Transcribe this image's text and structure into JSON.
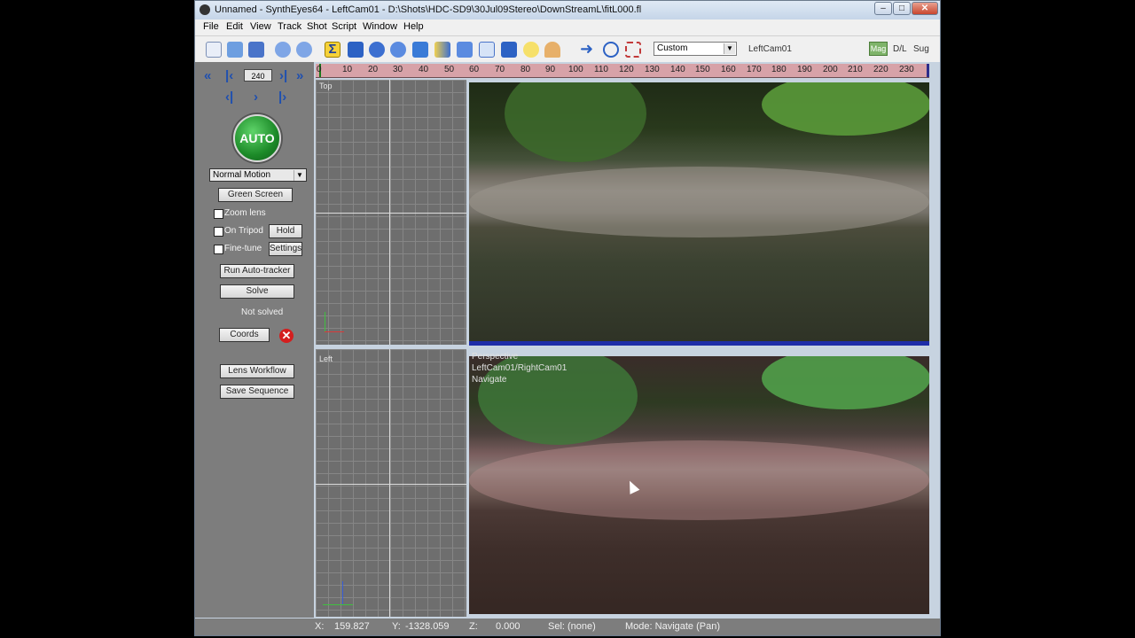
{
  "window": {
    "title": "Unnamed - SynthEyes64 - LeftCam01 - D:\\Shots\\HDC-SD9\\30Jul09Stereo\\DownStreamL\\fitL000.fl",
    "controls": {
      "minimize": "–",
      "maximize": "□",
      "close": "✕"
    }
  },
  "menu": [
    "File",
    "Edit",
    "View",
    "Track",
    "Shot",
    "Script",
    "Window",
    "Help"
  ],
  "toolbar": {
    "icons": [
      "new-file-icon",
      "open-folder-icon",
      "save-icon",
      "undo-icon",
      "redo-icon",
      "summary-icon",
      "camera-view-icon",
      "gear-icon",
      "tracker-icon",
      "move-icon",
      "lens-icon",
      "list-icon",
      "graph-icon",
      "cube-icon",
      "bulb-icon",
      "paint-icon",
      "arrow-right-icon",
      "zoom-icon",
      "fit-icon"
    ],
    "combo_value": "Custom",
    "camera": "LeftCam01",
    "mag_label": "Mag",
    "dl_label": "D/L",
    "sug_label": "Sug"
  },
  "left_panel": {
    "frame": "240",
    "auto_label": "AUTO",
    "motion_select": "Normal Motion",
    "green_screen": "Green Screen",
    "zoom_lens": "Zoom lens",
    "on_tripod": "On Tripod",
    "hold": "Hold",
    "fine_tune": "Fine-tune",
    "settings": "Settings",
    "run_autotracker": "Run Auto-tracker",
    "solve": "Solve",
    "status": "Not solved",
    "coords": "Coords",
    "lens_workflow": "Lens Workflow",
    "save_sequence": "Save Sequence"
  },
  "timebar": {
    "ticks": [
      "0",
      "10",
      "20",
      "30",
      "40",
      "50",
      "60",
      "70",
      "80",
      "90",
      "100",
      "110",
      "120",
      "130",
      "140",
      "150",
      "160",
      "170",
      "180",
      "190",
      "200",
      "210",
      "220",
      "230"
    ]
  },
  "viewports": {
    "top_label": "Top",
    "left_label": "Left",
    "perspective_lines": [
      "Perspective",
      "LeftCam01/RightCam01",
      "Navigate"
    ]
  },
  "statusbar": {
    "x_label": "X:",
    "x_value": "159.827",
    "y_label": "Y:",
    "y_value": "-1328.059",
    "z_label": "Z:",
    "z_value": "0.000",
    "sel": "Sel: (none)",
    "mode": "Mode: Navigate (Pan)"
  }
}
